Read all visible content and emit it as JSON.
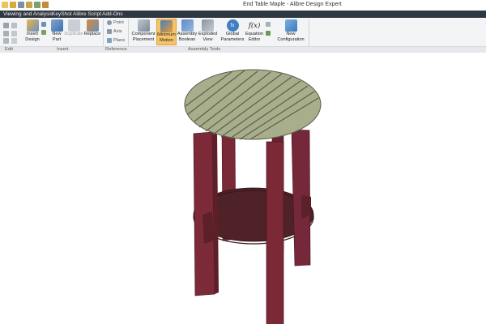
{
  "window": {
    "title": "End Table Maple - Alibre Design Expert"
  },
  "menu": {
    "tabs": [
      {
        "label": "Viewing and Analysis"
      },
      {
        "label": "KeyShot"
      },
      {
        "label": "Alibre Script"
      },
      {
        "label": "Add-Ons"
      }
    ]
  },
  "ribbon": {
    "insert_design": "Insert\nDesign",
    "new_part": "New\nPart",
    "duplicate": "Duplicate",
    "replace": "Replace",
    "point": "Point",
    "axis": "Axis",
    "plane": "Plane",
    "component_placement": "Component\nPlacement",
    "minimum_motion": "Minimum\nMotion",
    "assembly_boolean": "Assembly\nBoolean",
    "exploded_view": "Exploded\nView",
    "global_parameters": "Global\nParameters",
    "equation_editor": "Equation\nEditor",
    "new_configuration": "New\nConfiguration",
    "fx_glyph": "f(x)",
    "fx_icon_text": "fx"
  },
  "groups": {
    "edit": "Edit",
    "insert": "Insert",
    "reference": "Reference",
    "assembly_tools": "Assembly Tools"
  },
  "colors": {
    "menubar": "#2f3740",
    "active_button": "#f5c46a",
    "table_top": "#a8ad8c",
    "table_legs": "#6e2430",
    "shelf": "#4e2226"
  },
  "icons": {
    "qat": [
      "new-icon",
      "open-icon",
      "save-icon",
      "undo-icon",
      "redo-icon",
      "print-icon"
    ]
  }
}
